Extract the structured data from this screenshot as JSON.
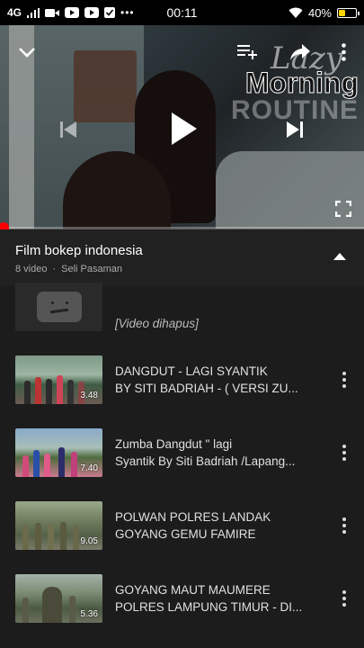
{
  "status_bar": {
    "network": "4G",
    "time": "00:11",
    "battery": "40%",
    "battery_level": 0.4
  },
  "player": {
    "overlay_line1": "Lazy",
    "overlay_line2": "Morning",
    "overlay_line3": "ROUTINE",
    "progress": 0.01,
    "icons": [
      "chevron-down-icon",
      "add-to-queue-icon",
      "share-icon",
      "more-vert-icon",
      "skip-previous-icon",
      "play-icon",
      "skip-next-icon",
      "fullscreen-icon"
    ]
  },
  "playlist": {
    "title": "Film bokep indonesia",
    "video_count": "8 video",
    "owner": "Seli Pasaman",
    "items": [
      {
        "deleted": true,
        "title": "[Video dihapus]"
      },
      {
        "line1": "DANGDUT - LAGI SYANTIK",
        "line2": "BY SITI BADRIAH -  ( VERSI ZU...",
        "duration": "3.48"
      },
      {
        "line1": "Zumba Dangdut  \" lagi",
        "line2": "Syantik By Siti Badriah /Lapang...",
        "duration": "7.40"
      },
      {
        "line1": "POLWAN POLRES LANDAK",
        "line2": "GOYANG GEMU FAMIRE",
        "duration": "9.05"
      },
      {
        "line1": "GOYANG MAUT MAUMERE",
        "line2": "POLRES LAMPUNG TIMUR - DI...",
        "duration": "5.36"
      }
    ]
  },
  "colors": {
    "accent": "#ff0000",
    "background": "#1c1c1c",
    "header": "#212121"
  }
}
